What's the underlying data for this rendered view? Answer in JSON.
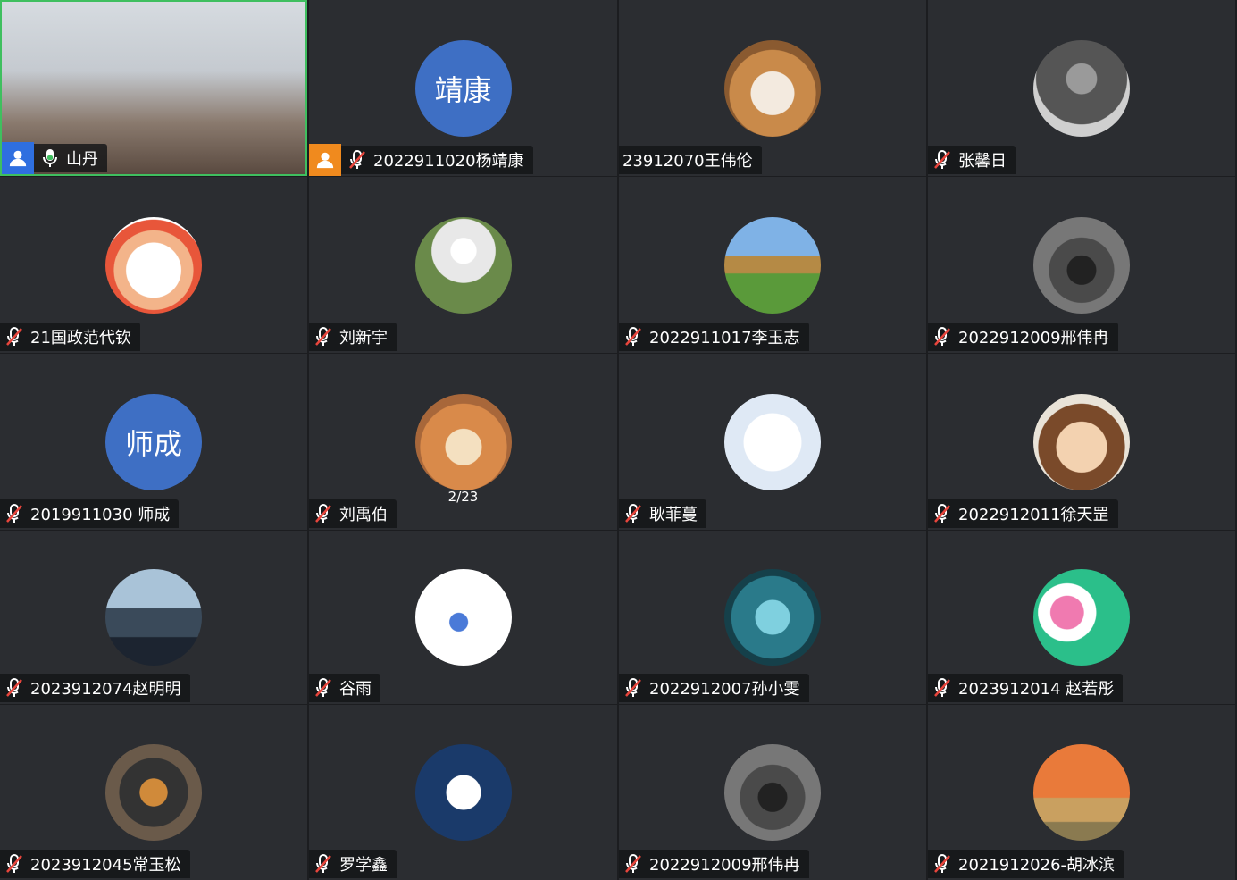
{
  "participants": [
    {
      "name": "山丹",
      "mic": "on",
      "role": "host",
      "video": true
    },
    {
      "name": "2022911020杨靖康",
      "mic": "muted",
      "role": "cohost",
      "avatar_text": "靖康"
    },
    {
      "name": "23912070王伟伦",
      "mic": "none",
      "avatar_icon": "dog-photo-icon"
    },
    {
      "name": "张馨日",
      "mic": "muted",
      "avatar_icon": "people-photo-icon"
    },
    {
      "name": "21国政范代钦",
      "mic": "muted",
      "avatar_icon": "cartoon-lion-icon"
    },
    {
      "name": "刘新宇",
      "mic": "muted",
      "avatar_icon": "astronaut-photo-icon"
    },
    {
      "name": "2022911017李玉志",
      "mic": "muted",
      "avatar_icon": "temple-photo-icon"
    },
    {
      "name": "2022912009邢伟冉",
      "mic": "muted",
      "avatar_icon": "photographer-photo-icon"
    },
    {
      "name": "2019911030 师成",
      "mic": "muted",
      "avatar_text": "师成"
    },
    {
      "name": "刘禹伯",
      "mic": "muted",
      "avatar_icon": "cat-photo-icon"
    },
    {
      "name": "耿菲蔓",
      "mic": "muted",
      "avatar_icon": "plush-lamb-icon"
    },
    {
      "name": "2022912011徐天罡",
      "mic": "muted",
      "avatar_icon": "anime-character-icon"
    },
    {
      "name": "2023912074赵明明",
      "mic": "muted",
      "avatar_icon": "woman-phone-photo-icon"
    },
    {
      "name": "谷雨",
      "mic": "muted",
      "avatar_icon": "sketch-figure-icon"
    },
    {
      "name": "2022912007孙小雯",
      "mic": "muted",
      "avatar_icon": "aquarium-photo-icon"
    },
    {
      "name": "2023912014 赵若彤",
      "mic": "muted",
      "avatar_icon": "heart-bunny-icon"
    },
    {
      "name": "2023912045常玉松",
      "mic": "muted",
      "avatar_icon": "food-photo-icon"
    },
    {
      "name": "罗学鑫",
      "mic": "muted",
      "avatar_icon": "panda-candy-icon"
    },
    {
      "name": "2022912009邢伟冉",
      "mic": "muted",
      "avatar_icon": "photographer-photo-icon"
    },
    {
      "name": "2021912026-胡冰滨",
      "mic": "muted",
      "avatar_icon": "sunset-photo-icon"
    }
  ],
  "page_indicator": "2/23",
  "colors": {
    "active_border": "#3fbf5f",
    "host_badge": "#2f6fe0",
    "cohost_badge": "#f08a1e",
    "avatar_blue": "#3e6fc4",
    "muted_red": "#e8453c"
  }
}
